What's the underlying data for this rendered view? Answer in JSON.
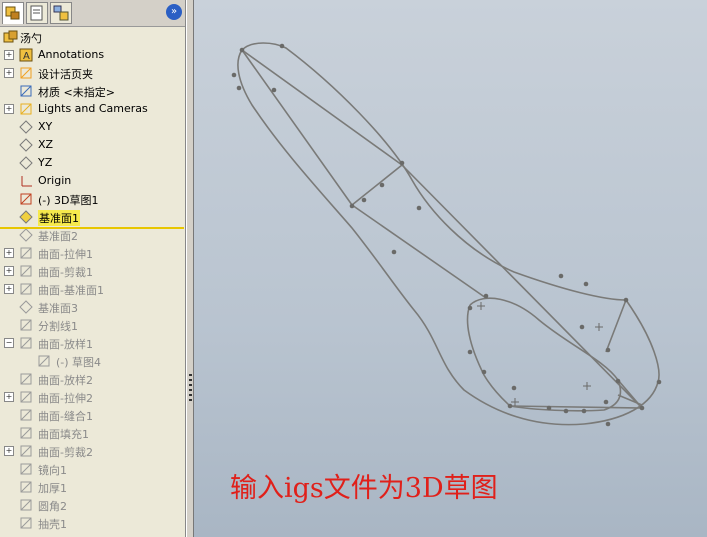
{
  "tree": {
    "root": "汤勺",
    "items": [
      {
        "label": "Annotations",
        "icon": "annotations-icon",
        "expand": "+",
        "state": "normal"
      },
      {
        "label": "设计活页夹",
        "icon": "design-binder-icon",
        "expand": "+",
        "state": "normal"
      },
      {
        "label": "材质 <未指定>",
        "icon": "material-icon",
        "expand": "",
        "state": "normal"
      },
      {
        "label": "Lights and Cameras",
        "icon": "lights-cameras-icon",
        "expand": "+",
        "state": "normal"
      },
      {
        "label": "XY",
        "icon": "plane-icon",
        "expand": "",
        "state": "normal"
      },
      {
        "label": "XZ",
        "icon": "plane-icon",
        "expand": "",
        "state": "normal"
      },
      {
        "label": "YZ",
        "icon": "plane-icon",
        "expand": "",
        "state": "normal"
      },
      {
        "label": "Origin",
        "icon": "origin-icon",
        "expand": "",
        "state": "normal"
      },
      {
        "label": "(-) 3D草图1",
        "icon": "3d-sketch-icon",
        "expand": "",
        "state": "normal"
      },
      {
        "label": "基准面1",
        "icon": "plane-icon",
        "expand": "",
        "state": "selected"
      },
      {
        "label": "基准面2",
        "icon": "plane-icon",
        "expand": "",
        "state": "suppressed"
      },
      {
        "label": "曲面-拉伸1",
        "icon": "surface-extrude-icon",
        "expand": "+",
        "state": "suppressed"
      },
      {
        "label": "曲面-剪裁1",
        "icon": "surface-trim-icon",
        "expand": "+",
        "state": "suppressed"
      },
      {
        "label": "曲面-基准面1",
        "icon": "surface-planar-icon",
        "expand": "+",
        "state": "suppressed"
      },
      {
        "label": "基准面3",
        "icon": "plane-icon",
        "expand": "",
        "state": "suppressed"
      },
      {
        "label": "分割线1",
        "icon": "split-line-icon",
        "expand": "",
        "state": "suppressed"
      },
      {
        "label": "曲面-放样1",
        "icon": "surface-loft-icon",
        "expand": "−",
        "state": "suppressed"
      },
      {
        "label": "(-) 草图4",
        "icon": "sketch-icon",
        "expand": "",
        "state": "suppressed",
        "indent": 1
      },
      {
        "label": "曲面-放样2",
        "icon": "surface-loft-icon",
        "expand": "",
        "state": "suppressed"
      },
      {
        "label": "曲面-拉伸2",
        "icon": "surface-extrude-icon",
        "expand": "+",
        "state": "suppressed"
      },
      {
        "label": "曲面-缝合1",
        "icon": "surface-knit-icon",
        "expand": "",
        "state": "suppressed"
      },
      {
        "label": "曲面填充1",
        "icon": "surface-fill-icon",
        "expand": "",
        "state": "suppressed"
      },
      {
        "label": "曲面-剪裁2",
        "icon": "surface-trim-icon",
        "expand": "+",
        "state": "suppressed"
      },
      {
        "label": "镜向1",
        "icon": "mirror-icon",
        "expand": "",
        "state": "suppressed"
      },
      {
        "label": "加厚1",
        "icon": "thicken-icon",
        "expand": "",
        "state": "suppressed"
      },
      {
        "label": "圆角2",
        "icon": "fillet-icon",
        "expand": "",
        "state": "suppressed"
      },
      {
        "label": "抽壳1",
        "icon": "shell-icon",
        "expand": "",
        "state": "suppressed"
      }
    ]
  },
  "tabs": [
    "feature-manager-tab",
    "property-manager-tab",
    "configuration-manager-tab"
  ],
  "expand_button": "»",
  "caption": "输入igs文件为3D草图",
  "colors": {
    "caption": "#e0201a",
    "sketch": "#7a7a78",
    "selected": "#f6e94c"
  }
}
